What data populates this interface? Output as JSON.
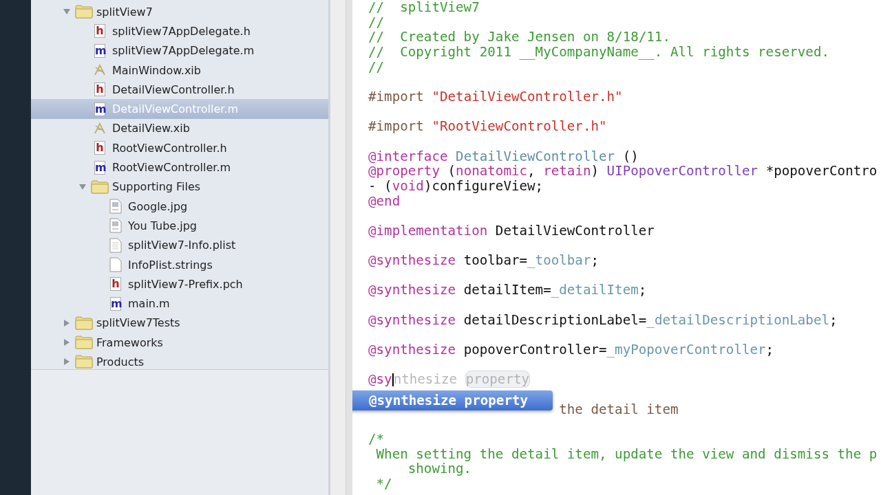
{
  "navigator": {
    "tree": [
      {
        "label": "splitView7",
        "kind": "folder",
        "expanded": true,
        "selected": false,
        "children": [
          {
            "label": "splitView7AppDelegate.h",
            "kind": "header",
            "icon_letter": "h",
            "selected": false
          },
          {
            "label": "splitView7AppDelegate.m",
            "kind": "implementation",
            "icon_letter": "m",
            "selected": false
          },
          {
            "label": "MainWindow.xib",
            "kind": "xib",
            "selected": false
          },
          {
            "label": "DetailViewController.h",
            "kind": "header",
            "icon_letter": "h",
            "selected": false
          },
          {
            "label": "DetailViewController.m",
            "kind": "implementation",
            "icon_letter": "m",
            "selected": true
          },
          {
            "label": "DetailView.xib",
            "kind": "xib",
            "selected": false
          },
          {
            "label": "RootViewController.h",
            "kind": "header",
            "icon_letter": "h",
            "selected": false
          },
          {
            "label": "RootViewController.m",
            "kind": "implementation",
            "icon_letter": "m",
            "selected": false
          },
          {
            "label": "Supporting Files",
            "kind": "folder",
            "expanded": true,
            "selected": false,
            "children": [
              {
                "label": "Google.jpg",
                "kind": "image",
                "selected": false
              },
              {
                "label": "You Tube.jpg",
                "kind": "image",
                "selected": false
              },
              {
                "label": "splitView7-Info.plist",
                "kind": "plist",
                "selected": false
              },
              {
                "label": "InfoPlist.strings",
                "kind": "strings",
                "selected": false
              },
              {
                "label": "splitView7-Prefix.pch",
                "kind": "header",
                "icon_letter": "h",
                "selected": false
              },
              {
                "label": "main.m",
                "kind": "implementation",
                "icon_letter": "m",
                "selected": false
              }
            ]
          }
        ]
      },
      {
        "label": "splitView7Tests",
        "kind": "folder",
        "expanded": false,
        "selected": false
      },
      {
        "label": "Frameworks",
        "kind": "folder",
        "expanded": false,
        "selected": false
      },
      {
        "label": "Products",
        "kind": "folder",
        "expanded": false,
        "selected": false
      }
    ]
  },
  "editor": {
    "lines": [
      {
        "kind": "code",
        "segments": [
          {
            "kind": "comment",
            "text": "//  splitView7"
          }
        ]
      },
      {
        "kind": "code",
        "segments": [
          {
            "kind": "comment",
            "text": "//"
          }
        ]
      },
      {
        "kind": "code",
        "segments": [
          {
            "kind": "comment",
            "text": "//  Created by Jake Jensen on 8/18/11."
          }
        ]
      },
      {
        "kind": "code",
        "segments": [
          {
            "kind": "comment",
            "text": "//  Copyright 2011 __MyCompanyName__. All rights reserved."
          }
        ]
      },
      {
        "kind": "code",
        "segments": [
          {
            "kind": "comment",
            "text": "//"
          }
        ]
      },
      {
        "kind": "blank"
      },
      {
        "kind": "code",
        "segments": [
          {
            "kind": "preproc",
            "text": "#import "
          },
          {
            "kind": "string",
            "text": "\"DetailViewController.h\""
          }
        ]
      },
      {
        "kind": "blank"
      },
      {
        "kind": "code",
        "segments": [
          {
            "kind": "preproc",
            "text": "#import "
          },
          {
            "kind": "string",
            "text": "\"RootViewController.h\""
          }
        ]
      },
      {
        "kind": "blank"
      },
      {
        "kind": "code",
        "segments": [
          {
            "kind": "keyword",
            "text": "@interface "
          },
          {
            "kind": "class",
            "text": "DetailViewController"
          },
          {
            "kind": "plain",
            "text": " ()"
          }
        ]
      },
      {
        "kind": "code",
        "segments": [
          {
            "kind": "keyword",
            "text": "@property "
          },
          {
            "kind": "plain",
            "text": "("
          },
          {
            "kind": "keyword",
            "text": "nonatomic"
          },
          {
            "kind": "plain",
            "text": ", "
          },
          {
            "kind": "keyword",
            "text": "retain"
          },
          {
            "kind": "plain",
            "text": ") "
          },
          {
            "kind": "type",
            "text": "UIPopoverController"
          },
          {
            "kind": "plain",
            "text": " *popoverContro"
          }
        ]
      },
      {
        "kind": "code",
        "segments": [
          {
            "kind": "plain",
            "text": "- ("
          },
          {
            "kind": "keyword",
            "text": "void"
          },
          {
            "kind": "plain",
            "text": ")configureView;"
          }
        ]
      },
      {
        "kind": "code",
        "segments": [
          {
            "kind": "keyword",
            "text": "@end"
          }
        ]
      },
      {
        "kind": "blank"
      },
      {
        "kind": "code",
        "segments": [
          {
            "kind": "keyword",
            "text": "@implementation "
          },
          {
            "kind": "plain",
            "text": "DetailViewController"
          }
        ]
      },
      {
        "kind": "blank"
      },
      {
        "kind": "code",
        "segments": [
          {
            "kind": "keyword",
            "text": "@synthesize "
          },
          {
            "kind": "plain",
            "text": "toolbar="
          },
          {
            "kind": "ivar",
            "text": "_toolbar"
          },
          {
            "kind": "plain",
            "text": ";"
          }
        ]
      },
      {
        "kind": "blank"
      },
      {
        "kind": "code",
        "segments": [
          {
            "kind": "keyword",
            "text": "@synthesize "
          },
          {
            "kind": "plain",
            "text": "detailItem="
          },
          {
            "kind": "ivar",
            "text": "_detailItem"
          },
          {
            "kind": "plain",
            "text": ";"
          }
        ]
      },
      {
        "kind": "blank"
      },
      {
        "kind": "code",
        "segments": [
          {
            "kind": "keyword",
            "text": "@synthesize "
          },
          {
            "kind": "plain",
            "text": "detailDescriptionLabel="
          },
          {
            "kind": "ivar",
            "text": "_detailDescriptionLabel"
          },
          {
            "kind": "plain",
            "text": ";"
          }
        ]
      },
      {
        "kind": "blank"
      },
      {
        "kind": "code",
        "segments": [
          {
            "kind": "keyword",
            "text": "@synthesize "
          },
          {
            "kind": "plain",
            "text": "popoverController="
          },
          {
            "kind": "ivar",
            "text": "_myPopoverController"
          },
          {
            "kind": "plain",
            "text": ";"
          }
        ]
      },
      {
        "kind": "blank"
      },
      {
        "kind": "code",
        "segments": [
          {
            "kind": "keyword",
            "text": "@sy"
          },
          {
            "kind": "cursor"
          },
          {
            "kind": "ghost",
            "text": "nthesize "
          },
          {
            "kind": "token",
            "text": "property"
          }
        ],
        "completion": "@synthesize property"
      },
      {
        "kind": "blank"
      },
      {
        "kind": "covered",
        "segments": [
          {
            "kind": "preproc",
            "text": "the detail item"
          }
        ]
      },
      {
        "kind": "blank"
      },
      {
        "kind": "code",
        "segments": [
          {
            "kind": "comment",
            "text": "/*"
          }
        ]
      },
      {
        "kind": "code",
        "segments": [
          {
            "kind": "comment",
            "text": " When setting the detail item, update the view and dismiss the p"
          }
        ]
      },
      {
        "kind": "code",
        "segments": [
          {
            "kind": "comment",
            "text": "     showing."
          }
        ]
      },
      {
        "kind": "code",
        "segments": [
          {
            "kind": "comment",
            "text": " */"
          }
        ]
      }
    ]
  }
}
